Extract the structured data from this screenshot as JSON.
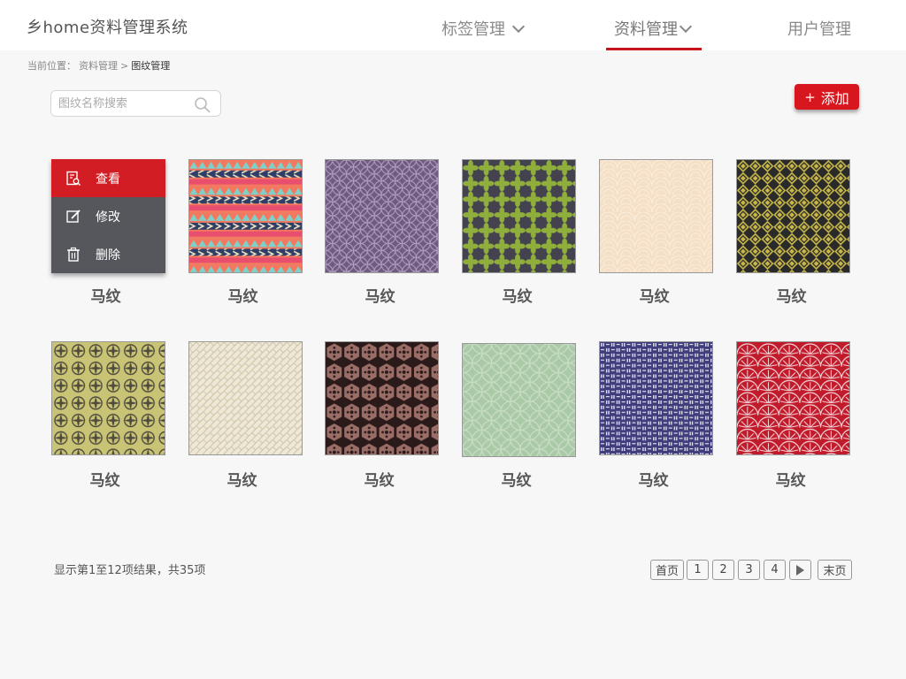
{
  "header": {
    "app_title": "乡home资料管理系统",
    "nav": [
      {
        "label": "标签管理",
        "has_dropdown": true
      },
      {
        "label": "资料管理",
        "has_dropdown": true,
        "active": true
      },
      {
        "label": "用户管理",
        "has_dropdown": false
      }
    ],
    "accent_color": "#c8151d"
  },
  "breadcrumb": {
    "prefix": "当前位置：",
    "parent": "资料管理",
    "separator": ">",
    "current": "图纹管理"
  },
  "search": {
    "placeholder": "图纹名称搜索",
    "value": "",
    "icon": "search-icon"
  },
  "add_button": {
    "icon": "+",
    "label": "添加",
    "color": "#d8161e"
  },
  "context_menu": {
    "items": [
      {
        "label": "查看",
        "icon": "view-doc-icon"
      },
      {
        "label": "修改",
        "icon": "edit-icon"
      },
      {
        "label": "删除",
        "icon": "trash-icon"
      }
    ]
  },
  "patterns": [
    {
      "name": "马纹",
      "pattern": "scales-red"
    },
    {
      "name": "马纹",
      "pattern": "chevron-stripes"
    },
    {
      "name": "马纹",
      "pattern": "purple-rings"
    },
    {
      "name": "马纹",
      "pattern": "green-quatrefoil"
    },
    {
      "name": "马纹",
      "pattern": "cream-fans"
    },
    {
      "name": "马纹",
      "pattern": "olive-diamonds"
    },
    {
      "name": "马纹",
      "pattern": "yellow-petals"
    },
    {
      "name": "马纹",
      "pattern": "beige-weave"
    },
    {
      "name": "马纹",
      "pattern": "brown-hexagons"
    },
    {
      "name": "马纹",
      "pattern": "mint-circles"
    },
    {
      "name": "马纹",
      "pattern": "navy-blocks"
    },
    {
      "name": "马纹",
      "pattern": "red-fans"
    }
  ],
  "pagination": {
    "summary": "显示第1至12项结果，共35项",
    "first": "首页",
    "pages": [
      "1",
      "2",
      "3",
      "4"
    ],
    "next_icon": "next-page-icon",
    "last": "末页"
  }
}
